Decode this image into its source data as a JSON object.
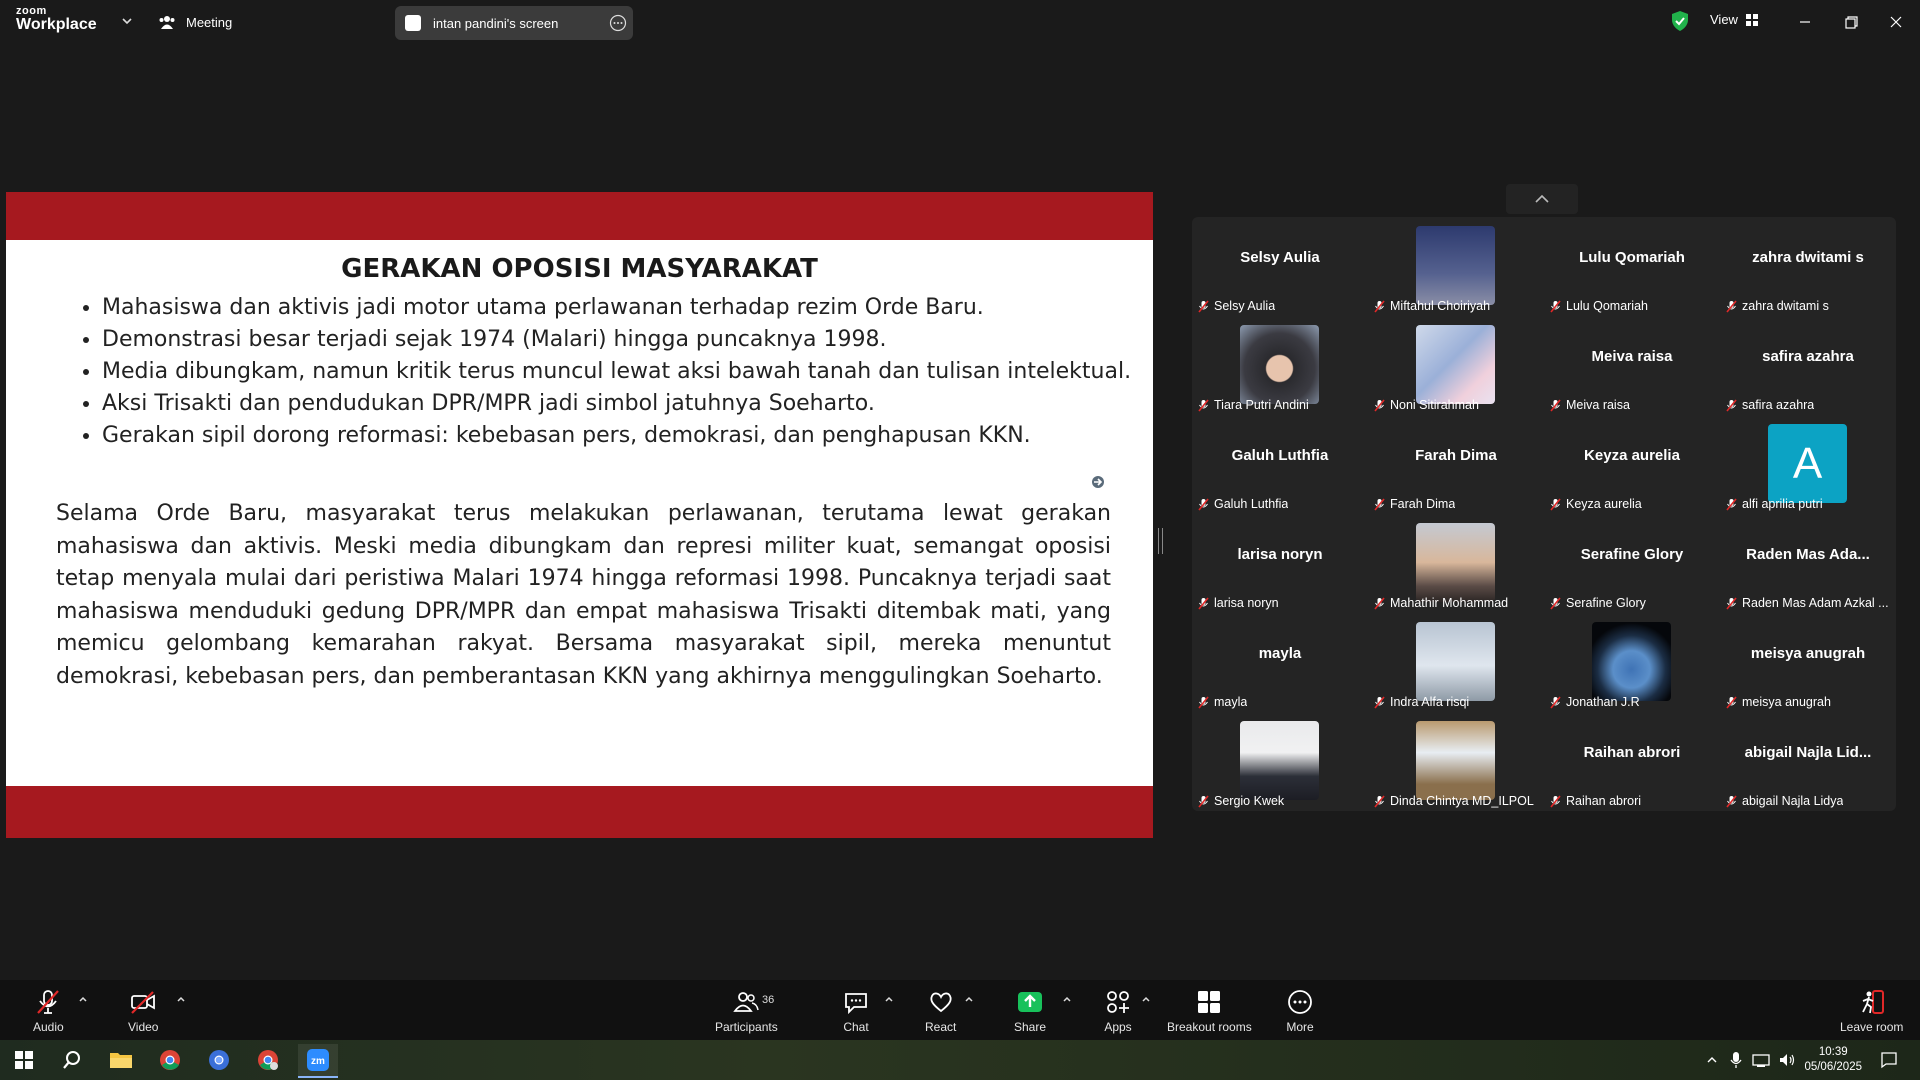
{
  "titlebar": {
    "brand_top": "zoom",
    "brand_bottom": "Workplace",
    "meeting_label": "Meeting",
    "shared_screen_label": "intan pandini's screen",
    "view_label": "View"
  },
  "slide": {
    "title": "GERAKAN OPOSISI MASYARAKAT",
    "bullets": [
      "Mahasiswa dan aktivis jadi motor utama perlawanan terhadap rezim Orde Baru.",
      "Demonstrasi besar terjadi sejak 1974 (Malari) hingga puncaknya 1998.",
      "Media dibungkam, namun kritik terus muncul lewat aksi bawah tanah dan tulisan intelektual.",
      "Aksi Trisakti dan pendudukan DPR/MPR jadi simbol jatuhnya Soeharto.",
      "Gerakan sipil dorong reformasi: kebebasan pers, demokrasi, dan penghapusan KKN."
    ],
    "paragraph": "Selama Orde Baru, masyarakat terus melakukan perlawanan, terutama lewat gerakan mahasiswa dan aktivis. Meski media dibungkam dan represi militer kuat, semangat oposisi tetap menyala mulai dari peristiwa Malari 1974 hingga reformasi 1998. Puncaknya terjadi saat mahasiswa menduduki gedung DPR/MPR dan empat mahasiswa Trisakti ditembak mati, yang memicu gelombang kemarahan rakyat. Bersama masyarakat sipil, mereka menuntut demokrasi, kebebasan pers, dan pemberantasan KKN yang akhirnya menggulingkan Soeharto."
  },
  "gallery": {
    "tiles": [
      {
        "big": "Selsy Aulia",
        "label": "Selsy Aulia"
      },
      {
        "big": "",
        "label": "Miftahul Choiriyah"
      },
      {
        "big": "Lulu  Qomariah",
        "label": "Lulu  Qomariah"
      },
      {
        "big": "zahra dwitami s",
        "label": "zahra dwitami s"
      },
      {
        "big": "",
        "label": "Tiara Putri Andini"
      },
      {
        "big": "",
        "label": "Noni Sitirahmah"
      },
      {
        "big": "Meiva raisa",
        "label": "Meiva raisa"
      },
      {
        "big": "safira azahra",
        "label": "safira azahra"
      },
      {
        "big": "Galuh Luthfia",
        "label": "Galuh Luthfia"
      },
      {
        "big": "Farah Dima",
        "label": "Farah Dima"
      },
      {
        "big": "Keyza aurelia",
        "label": "Keyza aurelia"
      },
      {
        "big": "",
        "label": "alfi aprilia putri",
        "avatar_letter": "A"
      },
      {
        "big": "larisa noryn",
        "label": "larisa noryn"
      },
      {
        "big": "",
        "label": "Mahathir Mohammad"
      },
      {
        "big": "Serafine Glory",
        "label": "Serafine Glory"
      },
      {
        "big": "Raden  Mas  Ada...",
        "label": "Raden Mas Adam Azkal ..."
      },
      {
        "big": "mayla",
        "label": "mayla"
      },
      {
        "big": "",
        "label": "Indra Alfa risqi"
      },
      {
        "big": "",
        "label": "Jonathan J.R"
      },
      {
        "big": "meisya anugrah",
        "label": "meisya anugrah"
      },
      {
        "big": "",
        "label": "Sergio Kwek"
      },
      {
        "big": "",
        "label": "Dinda Chintya MD_ILPOL"
      },
      {
        "big": "Raihan abrori",
        "label": "Raihan abrori"
      },
      {
        "big": "abigail  Najla  Lid...",
        "label": "abigail Najla Lidya"
      }
    ]
  },
  "toolbar": {
    "audio": "Audio",
    "video": "Video",
    "participants": "Participants",
    "participants_count": "36",
    "chat": "Chat",
    "react": "React",
    "share": "Share",
    "apps": "Apps",
    "breakout": "Breakout rooms",
    "more": "More",
    "leave": "Leave room"
  },
  "taskbar": {
    "time": "10:39",
    "date": "05/06/2025"
  },
  "colors": {
    "slide_band": "#a6191f",
    "share_green": "#18c15b",
    "leave_red": "#e02828",
    "avatar_teal": "#0ca3c4"
  }
}
